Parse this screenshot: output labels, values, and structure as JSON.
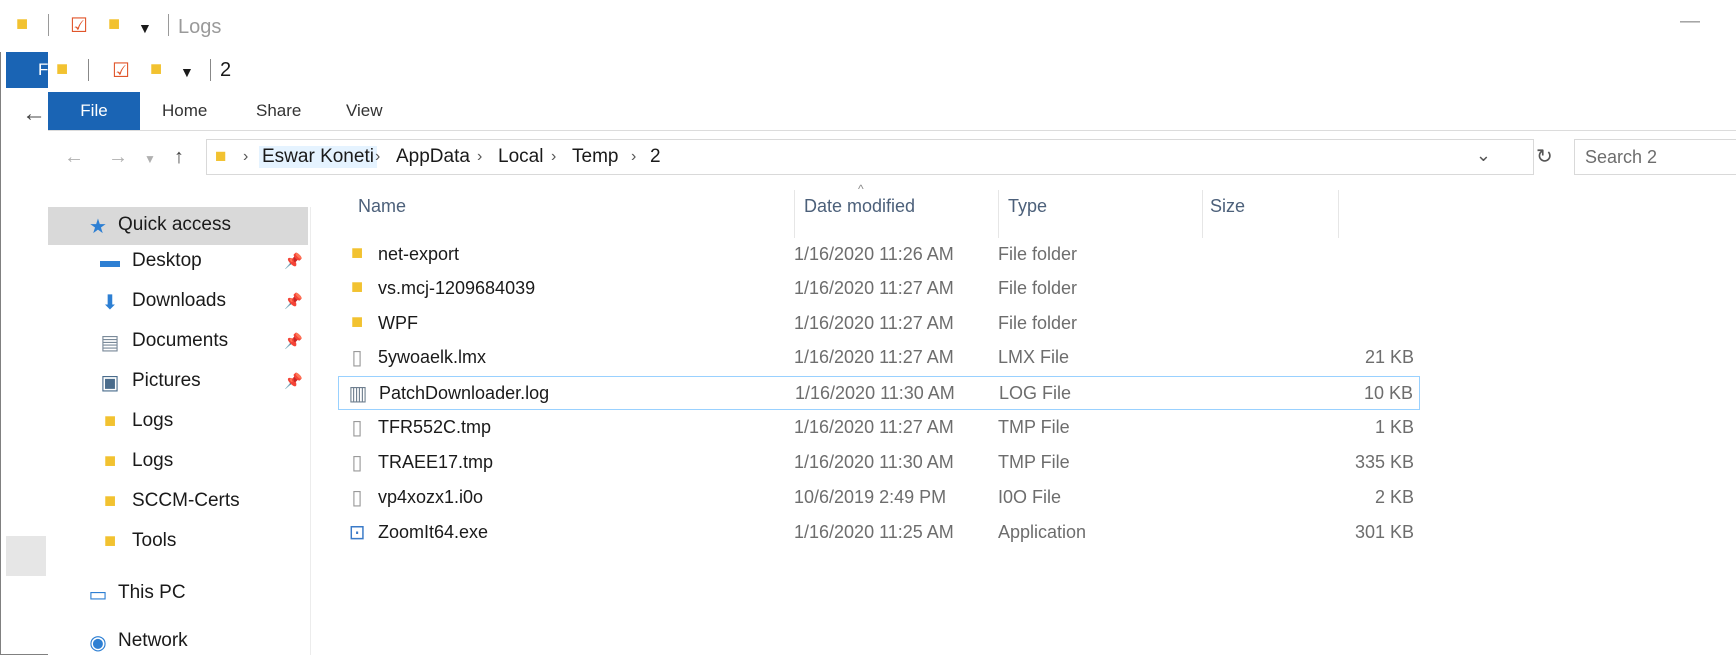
{
  "back_window": {
    "title": "Logs",
    "file_tab": "F"
  },
  "window": {
    "title": "2",
    "ribbon_tabs": [
      "File",
      "Home",
      "Share",
      "View"
    ]
  },
  "address_bar": {
    "breadcrumbs": [
      "Eswar Koneti",
      "AppData",
      "Local",
      "Temp",
      "2"
    ],
    "search_placeholder": "Search 2"
  },
  "nav_pane": {
    "items": [
      {
        "label": "Quick access",
        "icon": "star-icon",
        "pinned": false,
        "selected": true
      },
      {
        "label": "Desktop",
        "icon": "desktop-icon",
        "pinned": true
      },
      {
        "label": "Downloads",
        "icon": "download-arrow-icon",
        "pinned": true
      },
      {
        "label": "Documents",
        "icon": "documents-icon",
        "pinned": true
      },
      {
        "label": "Pictures",
        "icon": "pictures-icon",
        "pinned": true
      },
      {
        "label": "Logs",
        "icon": "folder-icon",
        "pinned": false
      },
      {
        "label": "Logs",
        "icon": "folder-icon",
        "pinned": false
      },
      {
        "label": "SCCM-Certs",
        "icon": "folder-icon",
        "pinned": false
      },
      {
        "label": "Tools",
        "icon": "folder-icon",
        "pinned": false
      },
      {
        "label": "This PC",
        "icon": "computer-icon",
        "pinned": false
      },
      {
        "label": "Network",
        "icon": "network-icon",
        "pinned": false
      }
    ]
  },
  "file_list": {
    "columns": [
      "Name",
      "Date modified",
      "Type",
      "Size"
    ],
    "rows": [
      {
        "name": "net-export",
        "date": "1/16/2020 11:26 AM",
        "type": "File folder",
        "size": "",
        "icon": "folder-icon"
      },
      {
        "name": "vs.mcj-1209684039",
        "date": "1/16/2020 11:27 AM",
        "type": "File folder",
        "size": "",
        "icon": "folder-icon"
      },
      {
        "name": "WPF",
        "date": "1/16/2020 11:27 AM",
        "type": "File folder",
        "size": "",
        "icon": "folder-icon"
      },
      {
        "name": "5ywoaelk.lmx",
        "date": "1/16/2020 11:27 AM",
        "type": "LMX File",
        "size": "21 KB",
        "icon": "file-icon"
      },
      {
        "name": "PatchDownloader.log",
        "date": "1/16/2020 11:30 AM",
        "type": "LOG File",
        "size": "10 KB",
        "icon": "log-file-icon",
        "selected": true
      },
      {
        "name": "TFR552C.tmp",
        "date": "1/16/2020 11:27 AM",
        "type": "TMP File",
        "size": "1 KB",
        "icon": "file-icon"
      },
      {
        "name": "TRAEE17.tmp",
        "date": "1/16/2020 11:30 AM",
        "type": "TMP File",
        "size": "335 KB",
        "icon": "file-icon"
      },
      {
        "name": "vp4xozx1.i0o",
        "date": "10/6/2019 2:49 PM",
        "type": "I0O File",
        "size": "2 KB",
        "icon": "file-icon"
      },
      {
        "name": "ZoomIt64.exe",
        "date": "1/16/2020 11:25 AM",
        "type": "Application",
        "size": "301 KB",
        "icon": "application-icon"
      }
    ]
  }
}
